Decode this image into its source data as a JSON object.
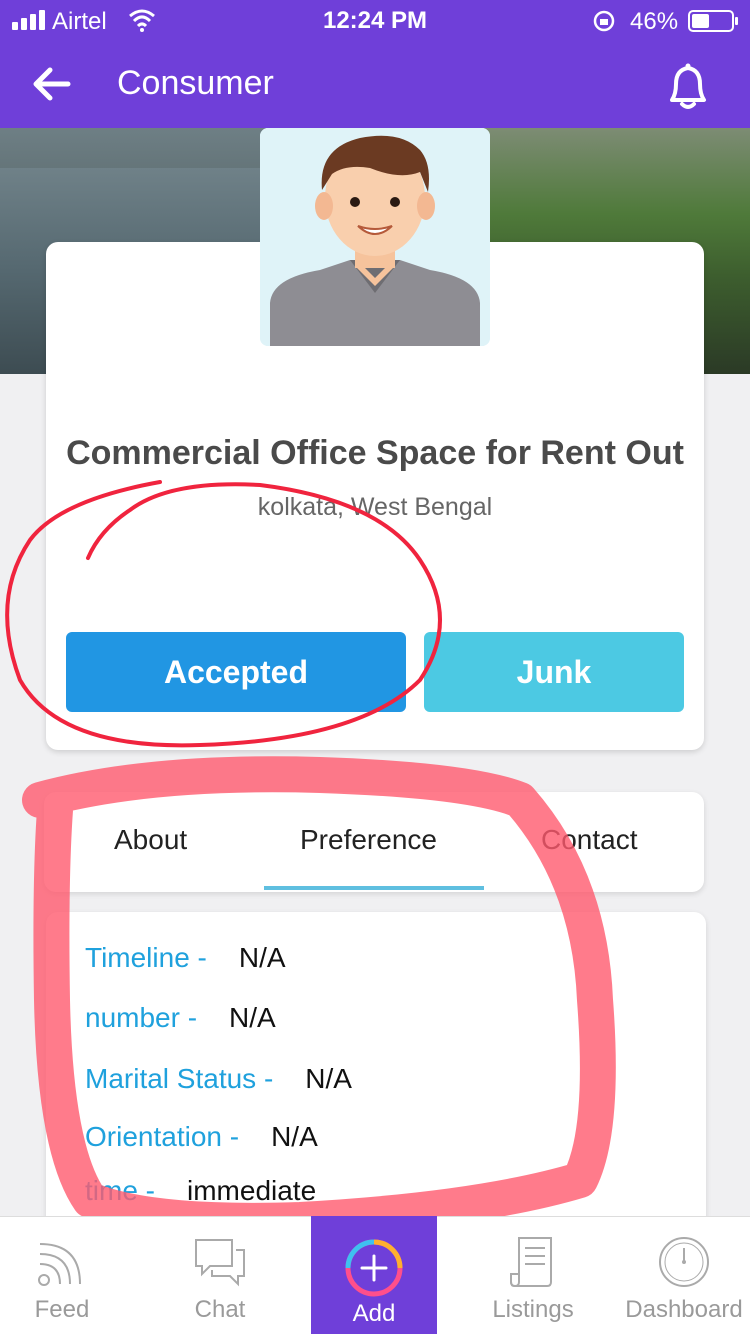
{
  "status_bar": {
    "carrier": "Airtel",
    "time": "12:24 PM",
    "battery_percent": "46%",
    "battery_level": 0.46
  },
  "header": {
    "title": "Consumer",
    "back_icon": "arrow-left-icon",
    "notification_icon": "bell-icon"
  },
  "listing": {
    "title": "Commercial Office Space for Rent Out",
    "location": "kolkata, West Bengal"
  },
  "actions": {
    "accepted_label": "Accepted",
    "junk_label": "Junk"
  },
  "tabs": [
    {
      "label": "About",
      "active": false
    },
    {
      "label": "Preference",
      "active": true
    },
    {
      "label": "Contact",
      "active": false
    }
  ],
  "preference": [
    {
      "label": "Timeline -",
      "value": "N/A"
    },
    {
      "label": "number -",
      "value": "N/A"
    },
    {
      "label": "Marital Status -",
      "value": "N/A"
    },
    {
      "label": "Orientation -",
      "value": "N/A"
    },
    {
      "label": "time -",
      "value": "immediate"
    }
  ],
  "bottom_nav": [
    {
      "label": "Feed",
      "icon": "feed-icon"
    },
    {
      "label": "Chat",
      "icon": "chat-icon"
    },
    {
      "label": "Add",
      "icon": "add-icon",
      "active": true
    },
    {
      "label": "Listings",
      "icon": "listings-icon"
    },
    {
      "label": "Dashboard",
      "icon": "dashboard-icon"
    }
  ],
  "colors": {
    "brand": "#6f3fd9",
    "accepted": "#2196e3",
    "junk": "#4cc9e3",
    "label_blue": "#1fa1dd",
    "annotation_red": "#f0243e"
  }
}
